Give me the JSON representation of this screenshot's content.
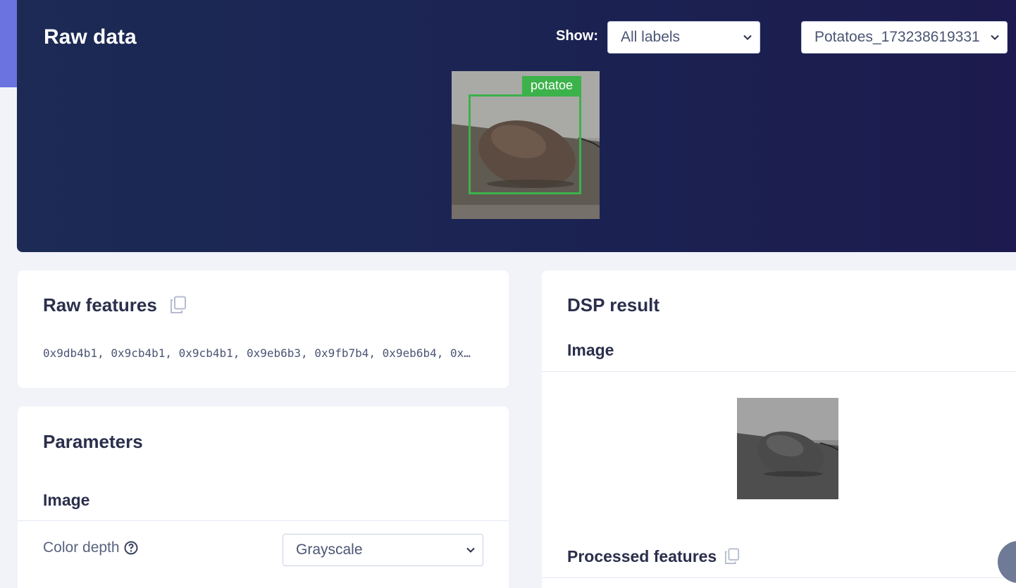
{
  "hero": {
    "title": "Raw data",
    "show_label": "Show:",
    "label_filter": "All labels",
    "sample_select": "Potatoes_173238619331",
    "bbox_label": "potatoe"
  },
  "raw_features": {
    "title": "Raw features",
    "values": "0x9db4b1, 0x9cb4b1, 0x9cb4b1, 0x9eb6b3, 0x9fb7b4, 0x9eb6b4, 0x…"
  },
  "parameters": {
    "title": "Parameters",
    "section": "Image",
    "color_depth_label": "Color depth",
    "color_depth_value": "Grayscale"
  },
  "dsp_result": {
    "title": "DSP result",
    "section": "Image",
    "processed_title": "Processed features"
  },
  "colors": {
    "hero_bg": "#1b2252",
    "accent": "#6a73e0",
    "bbox": "#3cb24a"
  }
}
